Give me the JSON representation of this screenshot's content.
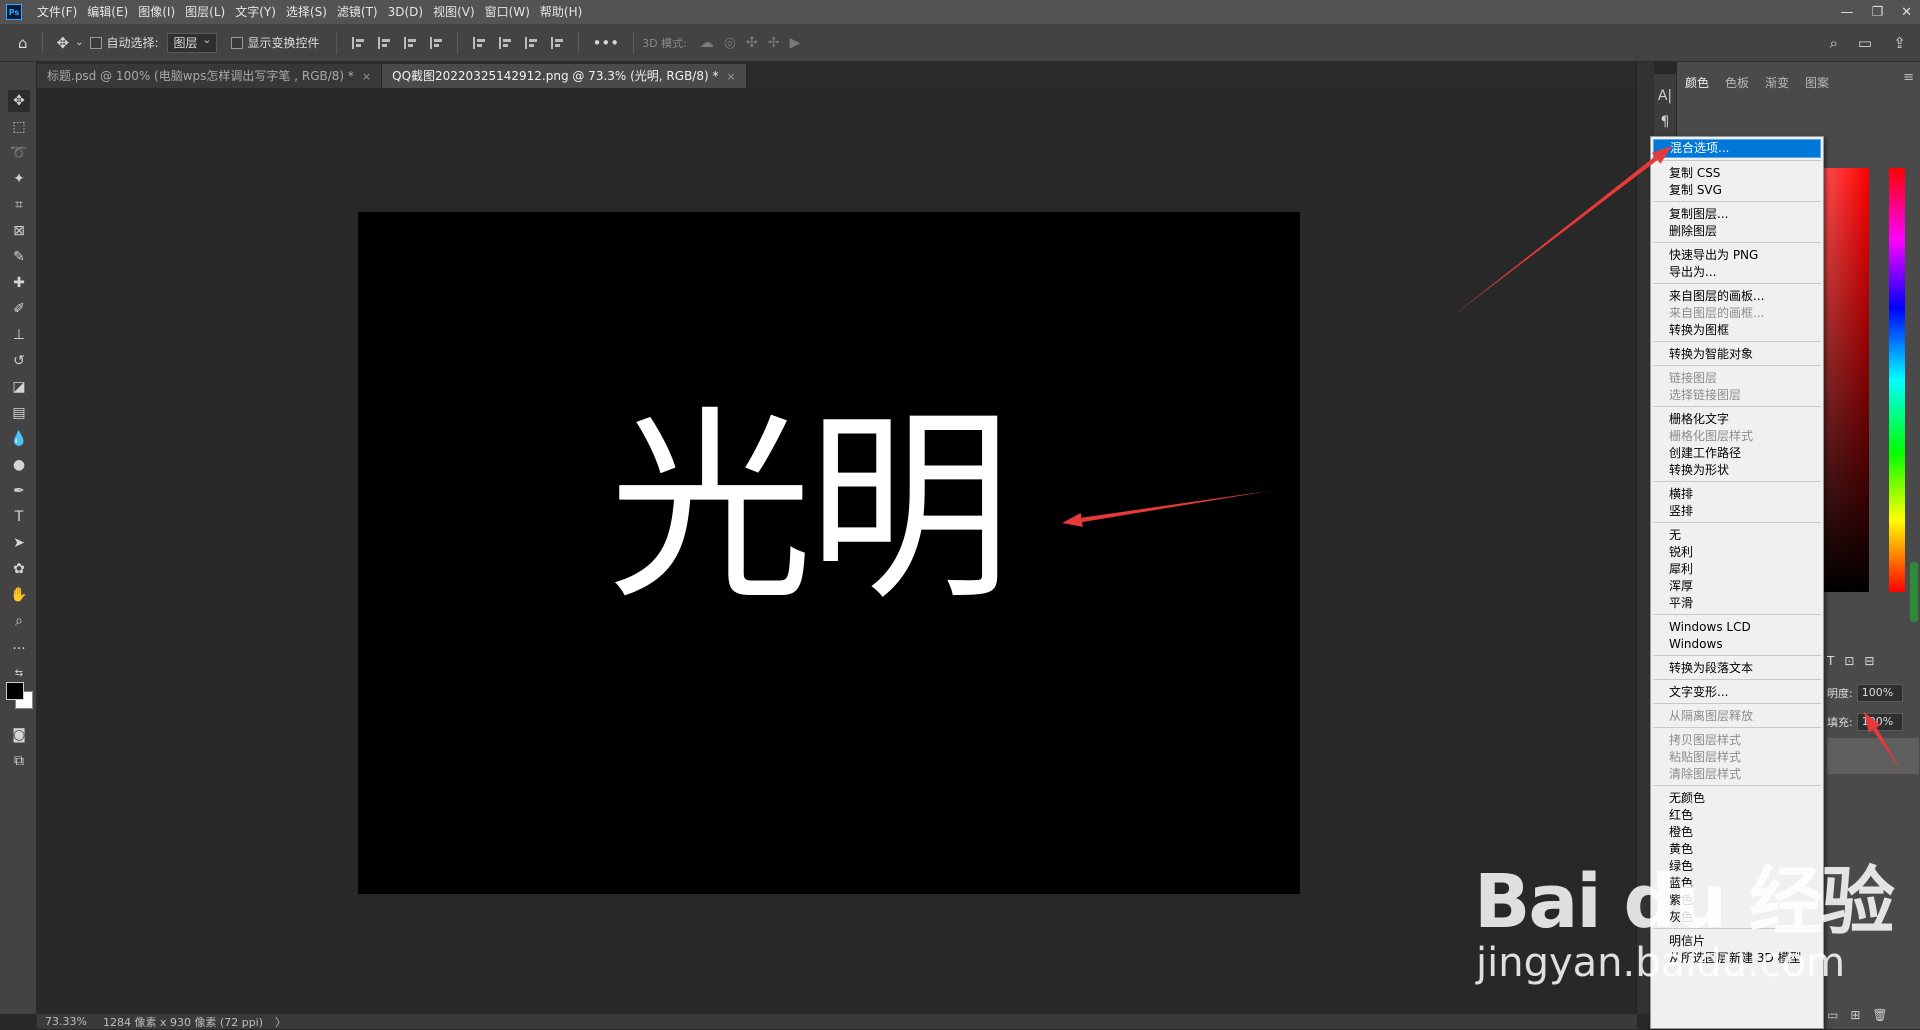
{
  "app": {
    "logo_text": "Ps",
    "menu": [
      "文件(F)",
      "编辑(E)",
      "图像(I)",
      "图层(L)",
      "文字(Y)",
      "选择(S)",
      "滤镜(T)",
      "3D(D)",
      "视图(V)",
      "窗口(W)",
      "帮助(H)"
    ]
  },
  "options_bar": {
    "auto_select_label": "自动选择:",
    "auto_select_value": "图层",
    "show_transform_label": "显示变换控件",
    "mode_label": "3D 模式:"
  },
  "tabs": [
    {
      "label": "标题.psd @ 100% (电脑wps怎样调出写字笔 , RGB/8) *",
      "close": "×",
      "active": false
    },
    {
      "label": "QQ截图20220325142912.png @ 73.3% (光明, RGB/8) *",
      "close": "×",
      "active": true
    }
  ],
  "canvas": {
    "text": "光明"
  },
  "status": {
    "zoom": "73.33%",
    "doc_info": "1284 像素 x 930 像素 (72 ppi)",
    "arrow": "〉"
  },
  "right_panel": {
    "tabs": [
      "颜色",
      "色板",
      "渐变",
      "图案"
    ],
    "opacity_label": "明度:",
    "opacity_value": "100%",
    "fill_label": "填充:",
    "fill_value": "100%"
  },
  "context_menu": {
    "groups": [
      [
        {
          "label": "混合选项...",
          "state": "highlight"
        }
      ],
      [
        {
          "label": "复制 CSS",
          "state": "normal"
        },
        {
          "label": "复制 SVG",
          "state": "normal"
        }
      ],
      [
        {
          "label": "复制图层...",
          "state": "normal"
        },
        {
          "label": "删除图层",
          "state": "normal"
        }
      ],
      [
        {
          "label": "快速导出为 PNG",
          "state": "normal"
        },
        {
          "label": "导出为...",
          "state": "normal"
        }
      ],
      [
        {
          "label": "来自图层的画板...",
          "state": "normal"
        },
        {
          "label": "来自图层的画框...",
          "state": "disabled"
        },
        {
          "label": "转换为图框",
          "state": "normal"
        }
      ],
      [
        {
          "label": "转换为智能对象",
          "state": "normal"
        }
      ],
      [
        {
          "label": "链接图层",
          "state": "disabled"
        },
        {
          "label": "选择链接图层",
          "state": "disabled"
        }
      ],
      [
        {
          "label": "栅格化文字",
          "state": "normal"
        },
        {
          "label": "栅格化图层样式",
          "state": "disabled"
        },
        {
          "label": "创建工作路径",
          "state": "normal"
        },
        {
          "label": "转换为形状",
          "state": "normal"
        }
      ],
      [
        {
          "label": "横排",
          "state": "normal"
        },
        {
          "label": "竖排",
          "state": "normal"
        }
      ],
      [
        {
          "label": "无",
          "state": "normal"
        },
        {
          "label": "锐利",
          "state": "normal"
        },
        {
          "label": "犀利",
          "state": "normal"
        },
        {
          "label": "浑厚",
          "state": "normal"
        },
        {
          "label": "平滑",
          "state": "normal"
        }
      ],
      [
        {
          "label": "Windows LCD",
          "state": "normal"
        },
        {
          "label": "Windows",
          "state": "normal"
        }
      ],
      [
        {
          "label": "转换为段落文本",
          "state": "normal"
        }
      ],
      [
        {
          "label": "文字变形...",
          "state": "normal"
        }
      ],
      [
        {
          "label": "从隔离图层释放",
          "state": "disabled"
        }
      ],
      [
        {
          "label": "拷贝图层样式",
          "state": "disabled"
        },
        {
          "label": "粘贴图层样式",
          "state": "disabled"
        },
        {
          "label": "清除图层样式",
          "state": "disabled"
        }
      ],
      [
        {
          "label": "无颜色",
          "state": "normal"
        },
        {
          "label": "红色",
          "state": "normal"
        },
        {
          "label": "橙色",
          "state": "normal"
        },
        {
          "label": "黄色",
          "state": "normal"
        },
        {
          "label": "绿色",
          "state": "normal"
        },
        {
          "label": "蓝色",
          "state": "normal"
        },
        {
          "label": "紫色",
          "state": "normal"
        },
        {
          "label": "灰色",
          "state": "normal"
        }
      ],
      [
        {
          "label": "明信片",
          "state": "normal"
        },
        {
          "label": "从所选图层新建 3D 模型",
          "state": "normal"
        }
      ]
    ]
  },
  "annotations": {
    "arrow_color": "#e8393a"
  },
  "watermark": {
    "brand": "Bai du 经验",
    "url": "jingyan.baidu.com"
  },
  "colors": {
    "fg": "#000000",
    "bg": "#ffffff",
    "menu_highlight": "#0078d7"
  }
}
